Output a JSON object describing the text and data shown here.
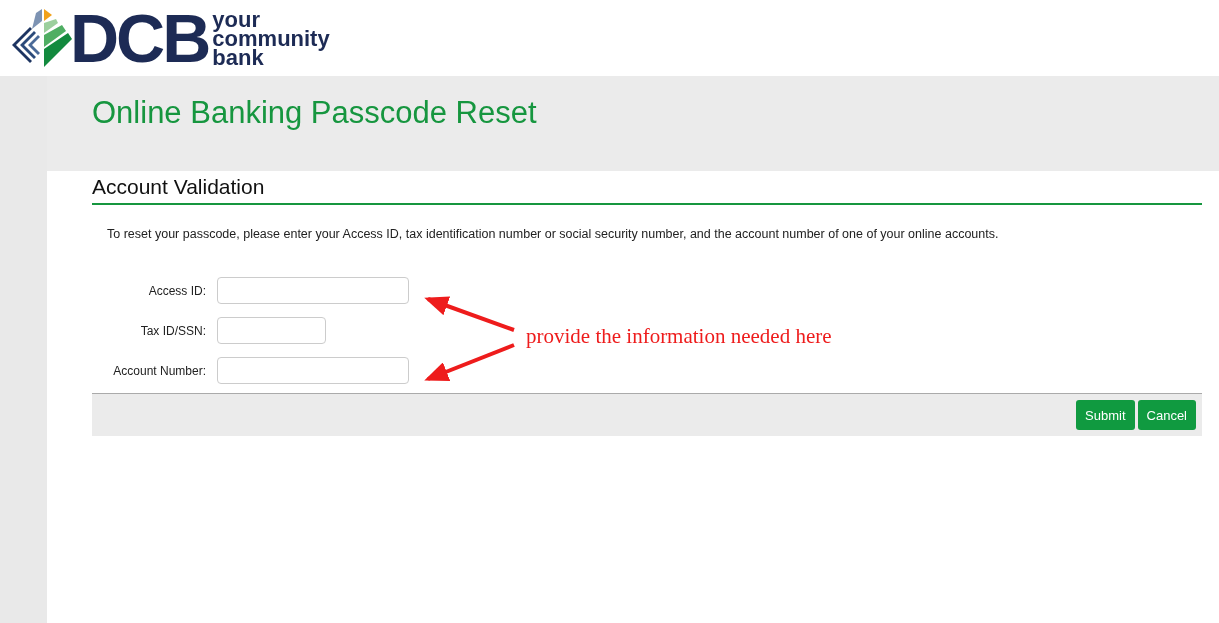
{
  "logo": {
    "mark": "DCB",
    "tagline": [
      "your",
      "community",
      "bank"
    ]
  },
  "title": "Online Banking Passcode Reset",
  "section": {
    "heading": "Account Validation",
    "instructions": "To reset your passcode, please enter your Access ID, tax identification number or social security number, and the account number of one of your online accounts."
  },
  "fields": [
    {
      "label": "Access ID:",
      "kind": "long"
    },
    {
      "label": "Tax ID/SSN:",
      "kind": "short"
    },
    {
      "label": "Account Number:",
      "kind": "long"
    }
  ],
  "annotation": "provide the information needed here",
  "buttons": [
    "Submit",
    "Cancel"
  ]
}
